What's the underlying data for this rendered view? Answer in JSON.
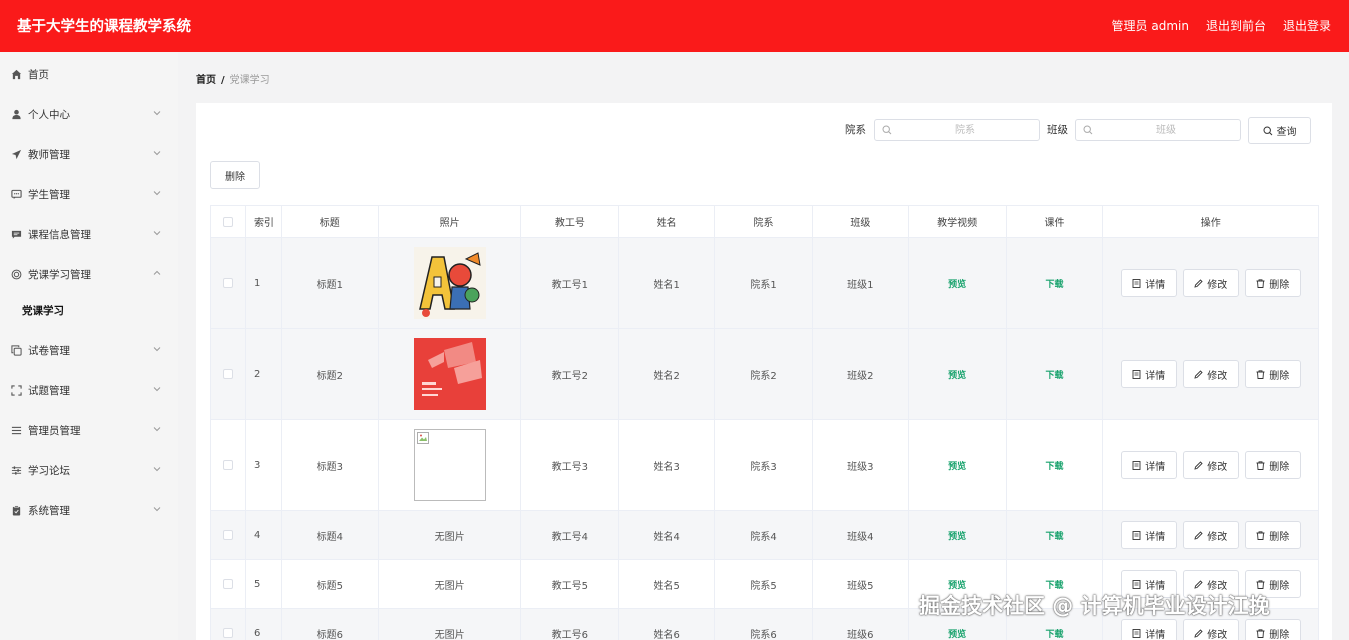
{
  "header": {
    "title": "基于大学生的课程教学系统",
    "links": [
      "管理员 admin",
      "退出到前台",
      "退出登录"
    ]
  },
  "sidebar": {
    "items": [
      {
        "label": "首页",
        "icon": "home-icon",
        "expandable": false
      },
      {
        "label": "个人中心",
        "icon": "user-icon",
        "expandable": true
      },
      {
        "label": "教师管理",
        "icon": "paper-plane-icon",
        "expandable": true
      },
      {
        "label": "学生管理",
        "icon": "chat-icon",
        "expandable": true
      },
      {
        "label": "课程信息管理",
        "icon": "message-icon",
        "expandable": true
      },
      {
        "label": "党课学习管理",
        "icon": "badge-icon",
        "expandable": true,
        "expanded": true
      },
      {
        "label": "试卷管理",
        "icon": "copy-icon",
        "expandable": true
      },
      {
        "label": "试题管理",
        "icon": "scan-icon",
        "expandable": true
      },
      {
        "label": "管理员管理",
        "icon": "list-icon",
        "expandable": true
      },
      {
        "label": "学习论坛",
        "icon": "sliders-icon",
        "expandable": true
      },
      {
        "label": "系统管理",
        "icon": "clipboard-icon",
        "expandable": true
      }
    ],
    "subitem": "党课学习"
  },
  "breadcrumb": {
    "home": "首页",
    "sep": "/",
    "current": "党课学习"
  },
  "filters": {
    "dept_label": "院系",
    "dept_placeholder": "院系",
    "class_label": "班级",
    "class_placeholder": "班级",
    "query_button": "查询"
  },
  "delete_button": "删除",
  "table": {
    "headers": [
      "索引",
      "标题",
      "照片",
      "教工号",
      "姓名",
      "院系",
      "班级",
      "教学视频",
      "课件",
      "操作"
    ],
    "rows": [
      {
        "index": "1",
        "title": "标题1",
        "photo": "image-a",
        "tid": "教工号1",
        "name": "姓名1",
        "dept": "院系1",
        "cls": "班级1",
        "video": "预览",
        "ware": "下载"
      },
      {
        "index": "2",
        "title": "标题2",
        "photo": "image-b",
        "tid": "教工号2",
        "name": "姓名2",
        "dept": "院系2",
        "cls": "班级2",
        "video": "预览",
        "ware": "下载"
      },
      {
        "index": "3",
        "title": "标题3",
        "photo": "broken",
        "tid": "教工号3",
        "name": "姓名3",
        "dept": "院系3",
        "cls": "班级3",
        "video": "预览",
        "ware": "下载"
      },
      {
        "index": "4",
        "title": "标题4",
        "photo": "无图片",
        "tid": "教工号4",
        "name": "姓名4",
        "dept": "院系4",
        "cls": "班级4",
        "video": "预览",
        "ware": "下载"
      },
      {
        "index": "5",
        "title": "标题5",
        "photo": "无图片",
        "tid": "教工号5",
        "name": "姓名5",
        "dept": "院系5",
        "cls": "班级5",
        "video": "预览",
        "ware": "下载"
      },
      {
        "index": "6",
        "title": "标题6",
        "photo": "无图片",
        "tid": "教工号6",
        "name": "姓名6",
        "dept": "院系6",
        "cls": "班级6",
        "video": "预览",
        "ware": "下载"
      }
    ],
    "ops": {
      "detail": "详情",
      "edit": "修改",
      "delete": "删除"
    }
  },
  "watermark": "掘金技术社区 @ 计算机毕业设计江挽"
}
